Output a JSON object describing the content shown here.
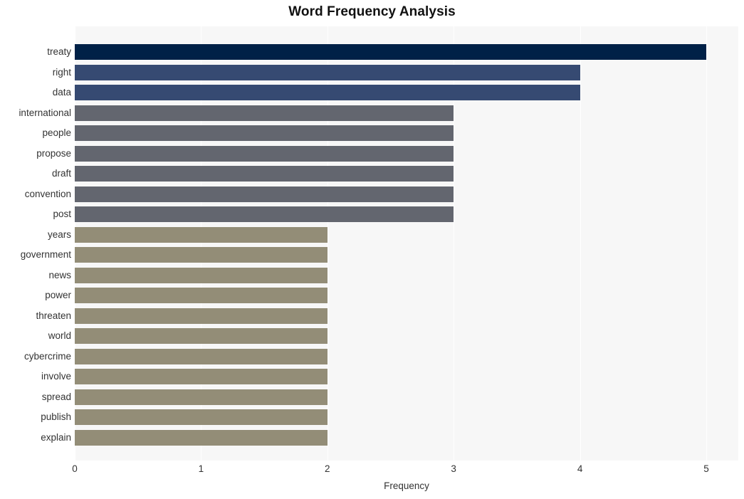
{
  "chart_data": {
    "type": "bar",
    "orientation": "horizontal",
    "title": "Word Frequency Analysis",
    "xlabel": "Frequency",
    "ylabel": "",
    "xlim": [
      0,
      5
    ],
    "xticks": [
      "0",
      "1",
      "2",
      "3",
      "4",
      "5"
    ],
    "grid": "vertical",
    "legend": "none",
    "categories": [
      "treaty",
      "right",
      "data",
      "international",
      "people",
      "propose",
      "draft",
      "convention",
      "post",
      "years",
      "government",
      "news",
      "power",
      "threaten",
      "world",
      "cybercrime",
      "involve",
      "spread",
      "publish",
      "explain"
    ],
    "values": [
      5,
      4,
      4,
      3,
      3,
      3,
      3,
      3,
      3,
      2,
      2,
      2,
      2,
      2,
      2,
      2,
      2,
      2,
      2,
      2
    ],
    "bar_colors": [
      "#002147",
      "#364a72",
      "#364a72",
      "#63666f",
      "#63666f",
      "#63666f",
      "#63666f",
      "#63666f",
      "#63666f",
      "#938d77",
      "#938d77",
      "#938d77",
      "#938d77",
      "#938d77",
      "#938d77",
      "#938d77",
      "#938d77",
      "#938d77",
      "#938d77",
      "#938d77"
    ]
  },
  "style": {
    "plot_background": "#f7f7f7",
    "figure_background": "#ffffff",
    "gridline_color": "#ffffff",
    "text_color": "#333333",
    "title_color": "#111111"
  }
}
